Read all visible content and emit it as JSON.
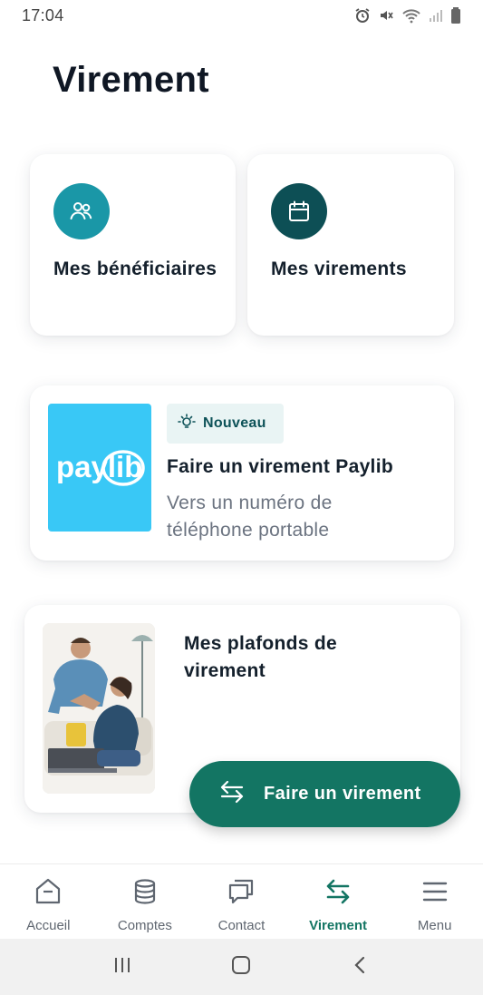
{
  "status_bar": {
    "time": "17:04"
  },
  "page": {
    "title": "Virement"
  },
  "shortcuts": [
    {
      "label": "Mes bénéficiaires",
      "icon": "users-icon",
      "color": "#1a97a7"
    },
    {
      "label": "Mes virements",
      "icon": "calendar-icon",
      "color": "#0d4f55"
    }
  ],
  "paylib": {
    "logo_text": "paylib",
    "logo_color": "#39c8f6",
    "badge": "Nouveau",
    "title": "Faire un virement Paylib",
    "subtitle": "Vers un numéro de téléphone portable"
  },
  "plafonds": {
    "label": "Mes plafonds de virement"
  },
  "fab": {
    "label": "Faire un virement",
    "color": "#137563"
  },
  "tabbar": {
    "items": [
      {
        "label": "Accueil",
        "icon": "home-icon",
        "active": false
      },
      {
        "label": "Comptes",
        "icon": "database-icon",
        "active": false
      },
      {
        "label": "Contact",
        "icon": "chat-icon",
        "active": false
      },
      {
        "label": "Virement",
        "icon": "transfer-icon",
        "active": true
      },
      {
        "label": "Menu",
        "icon": "menu-icon",
        "active": false
      }
    ],
    "active_color": "#137563"
  }
}
